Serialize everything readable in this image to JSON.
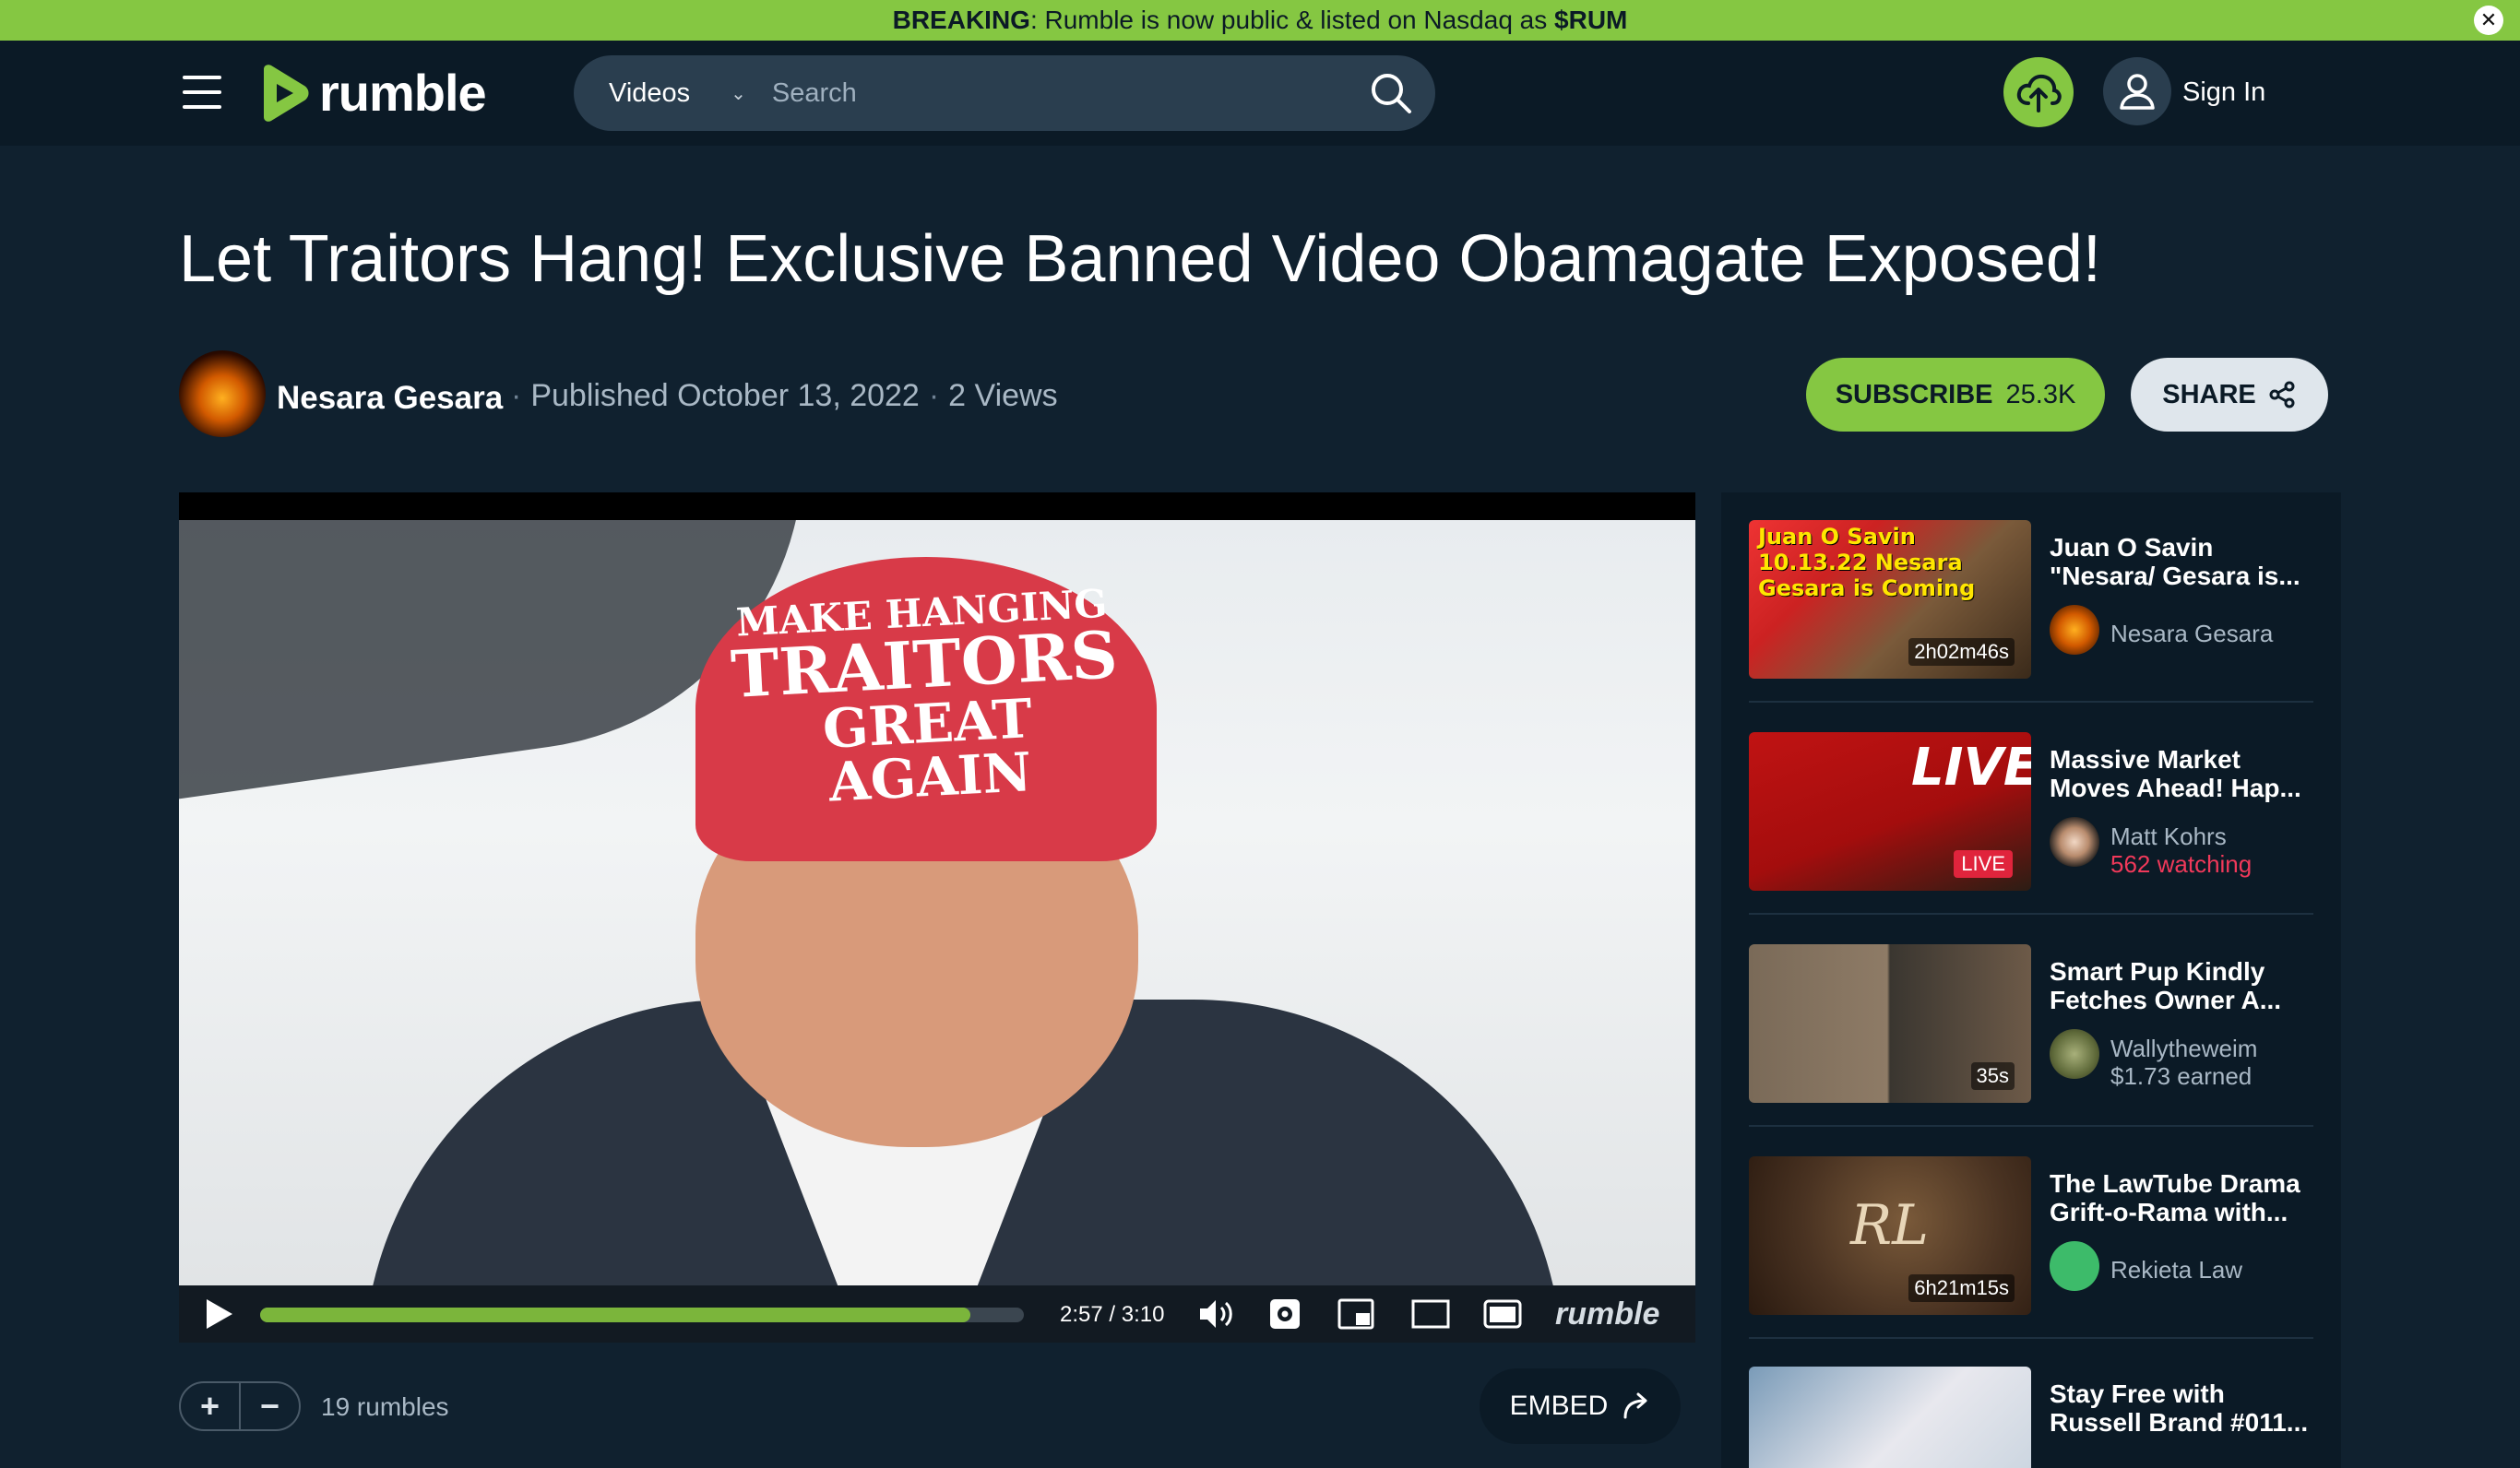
{
  "banner": {
    "label": "BREAKING",
    "text": ": Rumble is now public & listed on Nasdaq as ",
    "ticker": "$RUM",
    "close": "✕"
  },
  "header": {
    "logo": "rumble",
    "search_category": "Videos",
    "search_placeholder": "Search",
    "sign_in": "Sign In"
  },
  "video": {
    "title": "Let Traitors Hang! Exclusive Banned Video Obamagate Exposed!",
    "channel": "Nesara Gesara",
    "published": "Published October 13, 2022",
    "views": "2 Views",
    "subscribe_label": "SUBSCRIBE",
    "subscribers": "25.3K",
    "share_label": "SHARE",
    "cap_line1": "MAKE HANGING",
    "cap_line2": "TRAITORS",
    "cap_line3": "GREAT AGAIN",
    "time": "2:57 / 3:10",
    "progress": 0.93,
    "player_brand": "rumble",
    "rumbles": "19 rumbles",
    "embed_label": "EMBED"
  },
  "sidebar": {
    "items": [
      {
        "title": "Juan O Savin \"Nesara/ Gesara is...",
        "channel": "Nesara Gesara",
        "sub": "",
        "duration": "2h02m46s",
        "thumb_text": "Juan O Savin 10.13.22 Nesara Gesara is Coming"
      },
      {
        "title": "Massive Market Moves Ahead! Hap...",
        "channel": "Matt Kohrs",
        "sub": "562 watching",
        "duration": "LIVE",
        "thumb_text": "LIVE"
      },
      {
        "title": "Smart Pup Kindly Fetches Owner A...",
        "channel": "Wallytheweim",
        "sub": "$1.73 earned",
        "duration": "35s",
        "thumb_text": ""
      },
      {
        "title": "The LawTube Drama Grift-o-Rama with...",
        "channel": "Rekieta Law",
        "sub": "",
        "duration": "6h21m15s",
        "thumb_text": "RL"
      },
      {
        "title": "Stay Free with Russell Brand #011...",
        "channel": "",
        "sub": "",
        "duration": "",
        "thumb_text": ""
      }
    ]
  },
  "colors": {
    "accent": "#85c742",
    "background": "#10212f",
    "header": "#0b1a26",
    "live": "#e0243c"
  }
}
